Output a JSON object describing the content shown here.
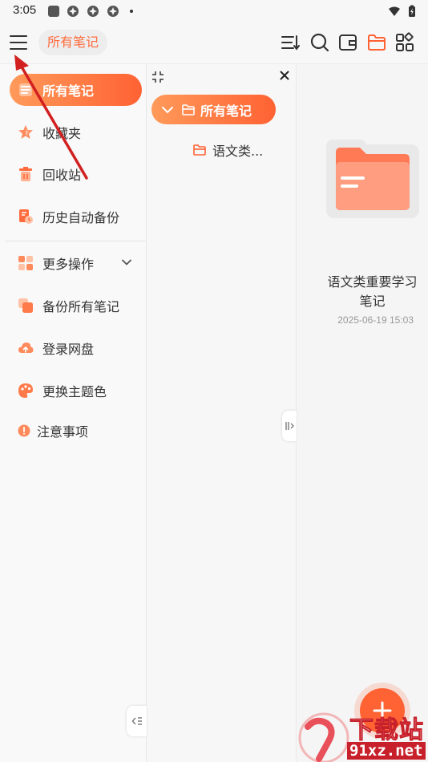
{
  "status_bar": {
    "time": "3:05"
  },
  "breadcrumb": {
    "label": "所有笔记"
  },
  "sidebar": {
    "items": [
      {
        "label": "所有笔记"
      },
      {
        "label": "收藏夹"
      },
      {
        "label": "回收站"
      },
      {
        "label": "历史自动备份"
      },
      {
        "label": "更多操作"
      },
      {
        "label": "备份所有笔记"
      },
      {
        "label": "登录网盘"
      },
      {
        "label": "更换主题色"
      },
      {
        "label": "注意事项"
      }
    ]
  },
  "tree": {
    "root_label": "所有笔记",
    "child_label": "语文类..."
  },
  "note": {
    "title": "语文类重要学习笔记",
    "date": "2025-06-19 15:03"
  },
  "watermark": {
    "text": "下载站",
    "url": "91xz.net"
  },
  "colors": {
    "accent": "#ff6233",
    "accent_light": "#ff9a5a",
    "folder": "#ff7a55"
  }
}
